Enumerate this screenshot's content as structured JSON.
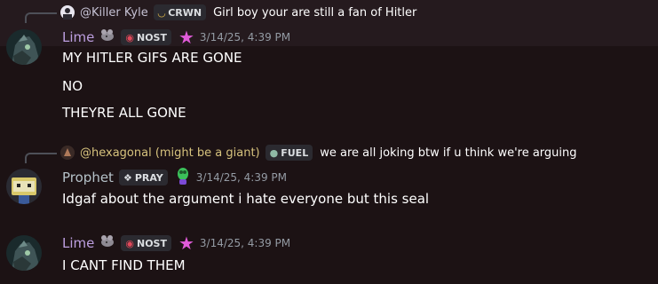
{
  "colors": {
    "background": "#1c1214",
    "highlight": "#251a1e",
    "lime_name": "#bd9fe0",
    "prophet_name": "#b5c1c8",
    "hexagonal_name": "#d6c27d",
    "killer_name": "#c6c2d4",
    "timestamp": "#949ba4",
    "tag_bg": "#2b2a30",
    "star": "#e05bd9"
  },
  "messages": [
    {
      "reply": {
        "name": "@Killer Kyle",
        "tag": "CRWN",
        "tag_icon": "crown-badge-icon",
        "text": "Girl boy your are still a fan of Hitler"
      },
      "author": "Lime",
      "tag": "NOST",
      "tag_icon": "nost-badge-icon",
      "icons": [
        "rat-icon",
        "star-icon"
      ],
      "timestamp": "3/14/25, 4:39 PM",
      "lines": [
        "MY HITLER GIFS ARE GONE",
        "NO",
        "THEYRE ALL GONE"
      ]
    },
    {
      "reply": {
        "name": "@hexagonal (might be a giant)",
        "tag": "FUEL",
        "tag_icon": "fuel-drop-icon",
        "text": "we are all joking btw if u think we're arguing"
      },
      "author": "Prophet",
      "tag": "PRAY",
      "tag_icon": "pray-badge-icon",
      "icons": [
        "green-creature-icon"
      ],
      "timestamp": "3/14/25, 4:39 PM",
      "lines": [
        "Idgaf about the argument i hate everyone but this seal"
      ]
    },
    {
      "author": "Lime",
      "tag": "NOST",
      "tag_icon": "nost-badge-icon",
      "icons": [
        "rat-icon",
        "star-icon"
      ],
      "timestamp": "3/14/25, 4:39 PM",
      "lines": [
        "I CANT FIND THEM"
      ]
    }
  ]
}
